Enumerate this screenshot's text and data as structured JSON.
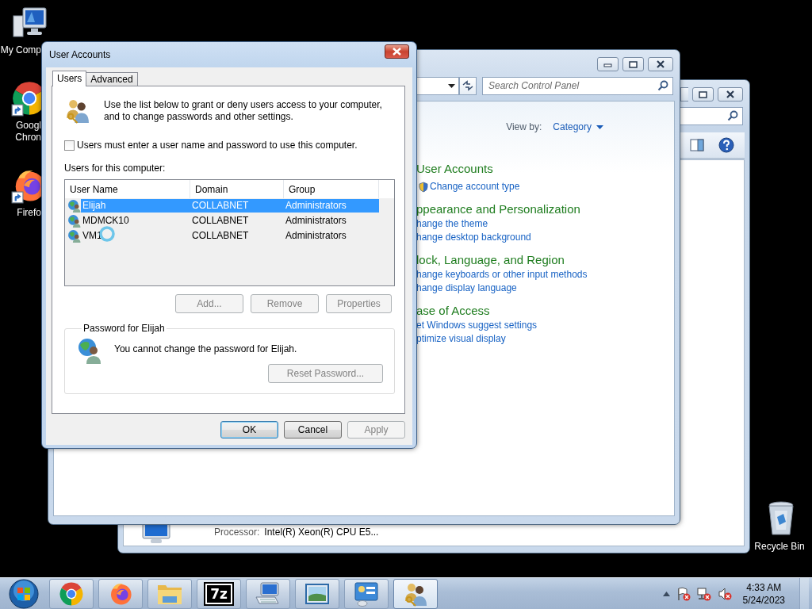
{
  "desktop_icons": [
    {
      "kind": "computer",
      "lines": [
        "My Comp"
      ]
    },
    {
      "kind": "chrome",
      "lines": [
        "Googl",
        "Chron"
      ]
    },
    {
      "kind": "firefox",
      "lines": [
        "Firefo"
      ]
    },
    {
      "kind": "recycle_bin",
      "lines": [
        "Recycle Bin"
      ]
    }
  ],
  "system_window": {
    "processor_label": "Processor:",
    "processor_value": "Intel(R) Xeon(R) CPU E5..."
  },
  "control_panel": {
    "search": {
      "placeholder": "Search Control Panel"
    },
    "view_by_label": "View by:",
    "view_by_value": "Category",
    "sections": [
      {
        "title": "User Accounts",
        "links": [
          {
            "text": "Change account type",
            "shield": true
          }
        ]
      },
      {
        "title": "ppearance and Personalization",
        "links": [
          {
            "text": "hange the theme",
            "shield": false
          },
          {
            "text": "hange desktop background",
            "shield": false
          }
        ]
      },
      {
        "title": "lock, Language, and Region",
        "links": [
          {
            "text": "hange keyboards or other input methods",
            "shield": false
          },
          {
            "text": "hange display language",
            "shield": false
          }
        ]
      },
      {
        "title": "ase of Access",
        "links": [
          {
            "text": "et Windows suggest settings",
            "shield": false
          },
          {
            "text": "ptimize visual display",
            "shield": false
          }
        ]
      }
    ]
  },
  "dialog": {
    "title": "User Accounts",
    "tabs": [
      {
        "label": "Users",
        "selected": true
      },
      {
        "label": "Advanced",
        "selected": false
      }
    ],
    "intro": "Use the list below to grant or deny users access to your computer, and to change passwords and other settings.",
    "require_password": {
      "label": "Users must enter a user name and password to use this computer.",
      "checked": false
    },
    "list_label": "Users for this computer:",
    "columns": [
      "User Name",
      "Domain",
      "Group"
    ],
    "rows": [
      {
        "cells": [
          "Elijah",
          "COLLABNET",
          "Administrators"
        ],
        "selected": true
      },
      {
        "cells": [
          "MDMCK10",
          "COLLABNET",
          "Administrators"
        ],
        "selected": false
      },
      {
        "cells": [
          "VM1",
          "COLLABNET",
          "Administrators"
        ],
        "selected": false
      }
    ],
    "list_buttons": [
      {
        "label": "Add...",
        "disabled": true
      },
      {
        "label": "Remove",
        "disabled": true
      },
      {
        "label": "Properties",
        "disabled": true
      }
    ],
    "password_group": {
      "title": "Password for Elijah",
      "message": "You cannot change the password for Elijah.",
      "button": {
        "label": "Reset Password...",
        "disabled": true
      }
    },
    "buttons": [
      {
        "label": "OK",
        "disabled": false,
        "default": true
      },
      {
        "label": "Cancel",
        "disabled": false,
        "default": false
      },
      {
        "label": "Apply",
        "disabled": true,
        "default": false
      }
    ]
  },
  "taskbar": {
    "items": [
      {
        "kind": "start",
        "selected": false
      },
      {
        "kind": "chrome",
        "selected": false
      },
      {
        "kind": "firefox",
        "selected": false
      },
      {
        "kind": "explorer",
        "selected": false
      },
      {
        "kind": "archiver",
        "label": "7z",
        "selected": false
      },
      {
        "kind": "keyboard",
        "selected": false
      },
      {
        "kind": "picture",
        "selected": false
      },
      {
        "kind": "control_panel",
        "selected": false
      },
      {
        "kind": "users",
        "selected": true
      }
    ]
  },
  "clock": {
    "time": "4:33 AM",
    "date": "5/24/2023"
  }
}
